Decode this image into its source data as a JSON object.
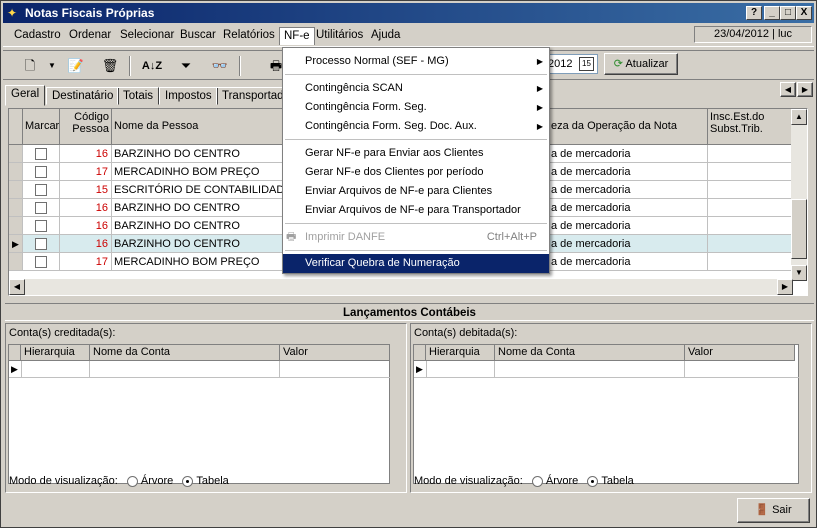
{
  "window": {
    "title": "Notas Fiscais Próprias",
    "help_btn": "?",
    "min_btn": "_",
    "max_btn": "□",
    "close_btn": "X"
  },
  "menu": [
    "Cadastro",
    "Ordenar",
    "Selecionar",
    "Buscar",
    "Relatórios",
    "NF-e",
    "Utilitários",
    "Ajuda"
  ],
  "status": {
    "date_user": "23/04/2012 | luc"
  },
  "toolbar": {
    "year_value": "2012",
    "calendar_icon": "15",
    "refresh_label": "Atualizar"
  },
  "tabs": [
    "Geral",
    "Destinatário",
    "Totais",
    "Impostos",
    "Transportador"
  ],
  "grid": {
    "headers": {
      "marcar": "Marcar",
      "codigo": "Código Pessoa",
      "nome": "Nome da Pessoa",
      "natureza": "eza da Operação da Nota",
      "insc": "Insc.Est.do Subst.Trib."
    },
    "rows": [
      {
        "codigo": "16",
        "nome": "BARZINHO DO CENTRO",
        "natureza": "a de mercadoria"
      },
      {
        "codigo": "17",
        "nome": "MERCADINHO BOM PREÇO",
        "natureza": "a de mercadoria"
      },
      {
        "codigo": "15",
        "nome": "ESCRITÓRIO DE CONTABILIDADE I",
        "natureza": "a de mercadoria"
      },
      {
        "codigo": "16",
        "nome": "BARZINHO DO CENTRO",
        "natureza": "a de mercadoria"
      },
      {
        "codigo": "16",
        "nome": "BARZINHO DO CENTRO",
        "natureza": "a de mercadoria"
      },
      {
        "codigo": "16",
        "nome": "BARZINHO DO CENTRO",
        "natureza": "a de mercadoria"
      },
      {
        "codigo": "17",
        "nome": "MERCADINHO BOM PREÇO",
        "natureza": "a de mercadoria"
      }
    ]
  },
  "nfe_menu": {
    "processo_normal": "Processo Normal (SEF - MG)",
    "contingencia_scan": "Contingência SCAN",
    "contingencia_form": "Contingência Form. Seg.",
    "contingencia_form_doc": "Contingência Form. Seg. Doc. Aux.",
    "gerar_enviar": "Gerar NF-e para Enviar aos Clientes",
    "gerar_periodo": "Gerar NF-e dos Clientes por período",
    "enviar_clientes": "Enviar Arquivos de NF-e para Clientes",
    "enviar_transportador": "Enviar Arquivos de NF-e para Transportador",
    "imprimir_danfe": "Imprimir DANFE",
    "imprimir_shortcut": "Ctrl+Alt+P",
    "verificar": "Verificar Quebra de Numeração"
  },
  "lancamentos": {
    "title": "Lançamentos Contábeis",
    "creditada_label": "Conta(s) creditada(s):",
    "debitada_label": "Conta(s) debitada(s):",
    "col_hierarquia": "Hierarquia",
    "col_nome": "Nome da Conta",
    "col_valor": "Valor",
    "modo_label": "Modo de visualização:",
    "opt_arvore": "Árvore",
    "opt_tabela": "Tabela"
  },
  "footer": {
    "sair_label": "Sair"
  },
  "colors": {
    "titlebar": "#0a246a",
    "menu_highlight": "#0a246a",
    "selected_row": "#d8ebee",
    "code_red": "#cc0000"
  }
}
